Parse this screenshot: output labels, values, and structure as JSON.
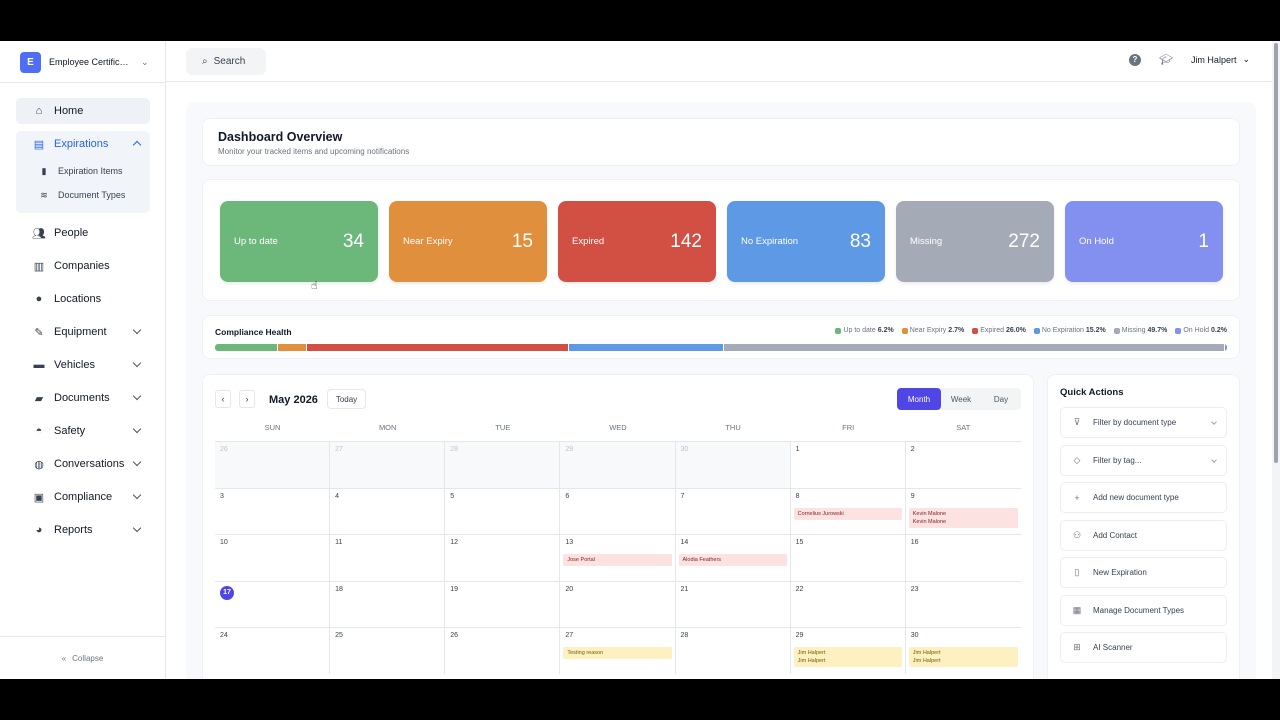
{
  "app": {
    "logo_letter": "E",
    "name": "Employee Certificatio..."
  },
  "search": {
    "label": "Search"
  },
  "user": {
    "name": "Jim Halpert"
  },
  "sidebar": {
    "home": "Home",
    "expirations": "Expirations",
    "expiration_items": "Expiration Items",
    "document_types": "Document Types",
    "people": "People",
    "companies": "Companies",
    "locations": "Locations",
    "equipment": "Equipment",
    "vehicles": "Vehicles",
    "documents": "Documents",
    "safety": "Safety",
    "conversations": "Conversations",
    "compliance": "Compliance",
    "reports": "Reports",
    "collapse": "Collapse"
  },
  "overview": {
    "title": "Dashboard Overview",
    "subtitle": "Monitor your tracked items and upcoming notifications"
  },
  "stats": [
    {
      "label": "Up to date",
      "value": "34",
      "color": "#6cb77a"
    },
    {
      "label": "Near Expiry",
      "value": "15",
      "color": "#e08f3d"
    },
    {
      "label": "Expired",
      "value": "142",
      "color": "#d24f44"
    },
    {
      "label": "No Expiration",
      "value": "83",
      "color": "#5d99e4"
    },
    {
      "label": "Missing",
      "value": "272",
      "color": "#a5abb6"
    },
    {
      "label": "On Hold",
      "value": "1",
      "color": "#8490ef"
    }
  ],
  "health": {
    "title": "Compliance Health",
    "segments": [
      {
        "label": "Up to date",
        "pct": "6.2%",
        "value": 6.2,
        "color": "#6cb77a"
      },
      {
        "label": "Near Expiry",
        "pct": "2.7%",
        "value": 2.7,
        "color": "#e08f3d"
      },
      {
        "label": "Expired",
        "pct": "26.0%",
        "value": 26.0,
        "color": "#d24f44"
      },
      {
        "label": "No Expiration",
        "pct": "15.2%",
        "value": 15.2,
        "color": "#5d99e4"
      },
      {
        "label": "Missing",
        "pct": "49.7%",
        "value": 49.7,
        "color": "#a5abb6"
      },
      {
        "label": "On Hold",
        "pct": "0.2%",
        "value": 0.2,
        "color": "#8490ef"
      }
    ]
  },
  "calendar": {
    "prev": "‹",
    "next": "›",
    "title": "May 2026",
    "today": "Today",
    "views": [
      "Month",
      "Week",
      "Day"
    ],
    "days_of_week": [
      "SUN",
      "MON",
      "TUE",
      "WED",
      "THU",
      "FRI",
      "SAT"
    ],
    "weeks": [
      [
        {
          "d": "26",
          "out": true
        },
        {
          "d": "27",
          "out": true
        },
        {
          "d": "28",
          "out": true
        },
        {
          "d": "29",
          "out": true
        },
        {
          "d": "30",
          "out": true
        },
        {
          "d": "1"
        },
        {
          "d": "2"
        }
      ],
      [
        {
          "d": "3"
        },
        {
          "d": "4"
        },
        {
          "d": "5"
        },
        {
          "d": "6"
        },
        {
          "d": "7"
        },
        {
          "d": "8",
          "ev": "Cornelius Jurowski",
          "evc": "red"
        },
        {
          "d": "9",
          "ev": "Kevin Malone\nKevin Malone",
          "evc": "red"
        }
      ],
      [
        {
          "d": "10"
        },
        {
          "d": "11"
        },
        {
          "d": "12"
        },
        {
          "d": "13",
          "ev": "Jose Portal",
          "evc": "red"
        },
        {
          "d": "14",
          "ev": "Alodia Feathers",
          "evc": "red"
        },
        {
          "d": "15"
        },
        {
          "d": "16"
        }
      ],
      [
        {
          "d": "17",
          "today": true
        },
        {
          "d": "18"
        },
        {
          "d": "19"
        },
        {
          "d": "20"
        },
        {
          "d": "21"
        },
        {
          "d": "22"
        },
        {
          "d": "23"
        }
      ],
      [
        {
          "d": "24"
        },
        {
          "d": "25"
        },
        {
          "d": "26"
        },
        {
          "d": "27",
          "ev": "Testing reason",
          "evc": "yel"
        },
        {
          "d": "28"
        },
        {
          "d": "29",
          "ev": "Jim Halpert\nJim Halpert",
          "evc": "yel"
        },
        {
          "d": "30",
          "ev": "Jim Halpert\nJim Halpert",
          "evc": "yel"
        }
      ]
    ]
  },
  "quick_actions": {
    "title": "Quick Actions",
    "items": [
      {
        "label": "Filter by document type",
        "icon": "⊽",
        "dropdown": true
      },
      {
        "label": "Filter by tag...",
        "icon": "◇",
        "dropdown": true
      },
      {
        "label": "Add new document type",
        "icon": "+"
      },
      {
        "label": "Add Contact",
        "icon": "⚇"
      },
      {
        "label": "New Expiration",
        "icon": "▯"
      },
      {
        "label": "Manage Document Types",
        "icon": "▦"
      },
      {
        "label": "AI Scanner",
        "icon": "⊞"
      }
    ]
  }
}
